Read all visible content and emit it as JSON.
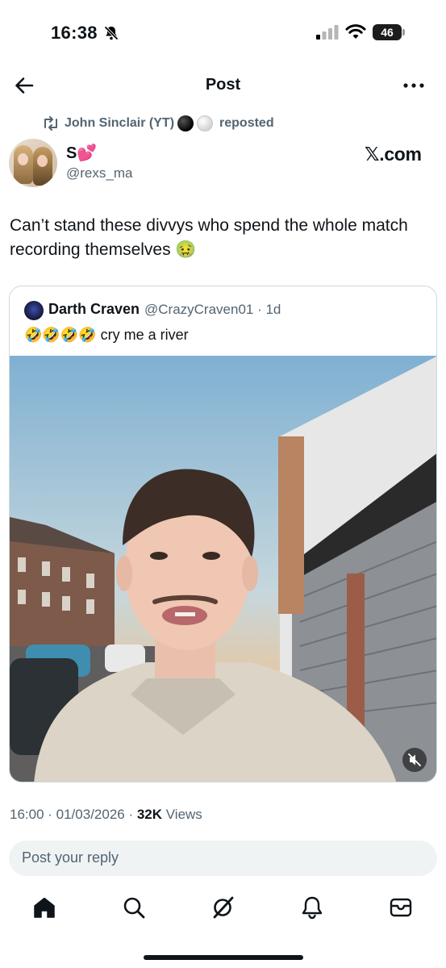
{
  "status_bar": {
    "time": "16:38",
    "battery": "46"
  },
  "nav": {
    "title": "Post"
  },
  "repost": {
    "user": "John Sinclair (YT)",
    "action": "reposted"
  },
  "post": {
    "author_name": "S💕",
    "author_handle": "@rexs_ma",
    "source_label": "𝕏.com",
    "text": "Can’t stand these divvys who spend the whole match recording themselves 🤢"
  },
  "quoted_post": {
    "author_name": "Darth Craven",
    "author_handle": "@CrazyCraven01 · 1d",
    "text": "🤣🤣🤣🤣 cry me a river"
  },
  "meta": {
    "time_date": "16:00 · 01/03/2026 · ",
    "views_count": "32K",
    "views_label": " Views"
  },
  "reply": {
    "placeholder": "Post your reply"
  },
  "tabbar": {
    "icons": [
      "home-icon",
      "search-icon",
      "grok-icon",
      "notifications-icon",
      "messages-icon"
    ]
  },
  "colors": {
    "text": "#0f1419",
    "secondary": "#536471",
    "border": "#cfd9de",
    "input_bg": "#eff3f4"
  }
}
